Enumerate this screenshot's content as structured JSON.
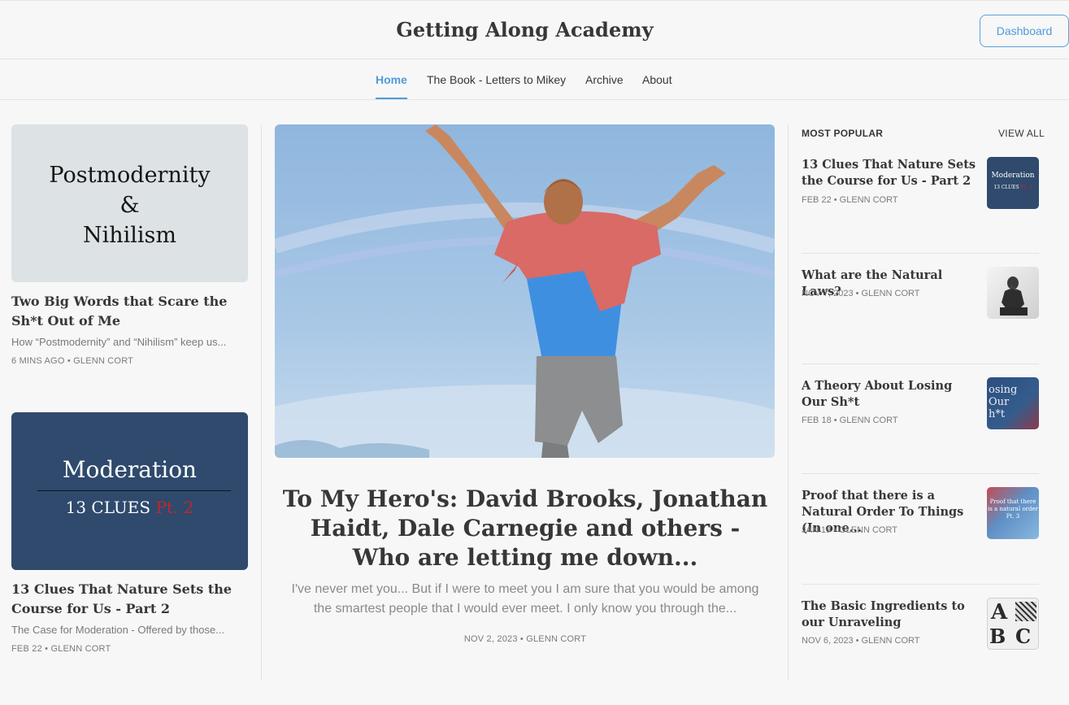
{
  "header": {
    "site_title": "Getting Along Academy",
    "dashboard_label": "Dashboard"
  },
  "nav": {
    "items": [
      {
        "label": "Home",
        "active": true
      },
      {
        "label": "The Book - Letters to Mikey",
        "active": false
      },
      {
        "label": "Archive",
        "active": false
      },
      {
        "label": "About",
        "active": false
      }
    ]
  },
  "left_posts": [
    {
      "image_text": [
        "Postmodernity",
        "&",
        "Nihilism"
      ],
      "title": "Two Big Words that Scare the Sh*t Out of Me",
      "subtitle": "How “Postmodernity” and “Nihilism” keep us...",
      "meta": "6 MINS AGO • GLENN CORT"
    },
    {
      "image_text": {
        "line1": "Moderation",
        "line2a": "13 CLUES",
        "line2b": "Pt. 2"
      },
      "title": "13 Clues That Nature Sets the Course for Us - Part 2",
      "subtitle": "The Case for Moderation - Offered by those...",
      "meta": "FEB 22 • GLENN CORT"
    }
  ],
  "featured": {
    "title": "To My Hero's: David Brooks, Jonathan Haidt, Dale Carnegie and others - Who are letting me down...",
    "subtitle": "I've never met you... But if I were to meet you I am sure that you would be among the smartest people that I would ever meet. I only know you through the...",
    "meta": "NOV 2, 2023 • GLENN CORT"
  },
  "popular": {
    "heading": "MOST POPULAR",
    "view_all": "VIEW ALL",
    "items": [
      {
        "title": "13 Clues That Nature Sets the Course for Us - Part 2",
        "meta": "FEB 22 • GLENN CORT",
        "thumb_text": [
          "Moderation",
          "13 CLUES",
          "Pt. 2"
        ]
      },
      {
        "title": "What are the Natural Laws?",
        "meta": "NOV 7, 2023 • GLENN CORT"
      },
      {
        "title": "A Theory About Losing Our Sh*t",
        "meta": "FEB 18 • GLENN CORT",
        "thumb_text": [
          "osing",
          "Our",
          "h*t"
        ]
      },
      {
        "title": "Proof that there is a Natural Order To Things (In one...",
        "meta": "JAN 19 • GLENN CORT",
        "thumb_text": [
          "Proof that there",
          "is a natural order",
          "Pt. 3"
        ]
      },
      {
        "title": "The Basic Ingredients to our Unraveling",
        "meta": "NOV 6, 2023 • GLENN CORT",
        "thumb_text": [
          "A",
          "B",
          "C"
        ]
      }
    ]
  },
  "colors": {
    "accent": "#4f9bdc",
    "navy": "#2f4a6d",
    "text": "#363737"
  }
}
